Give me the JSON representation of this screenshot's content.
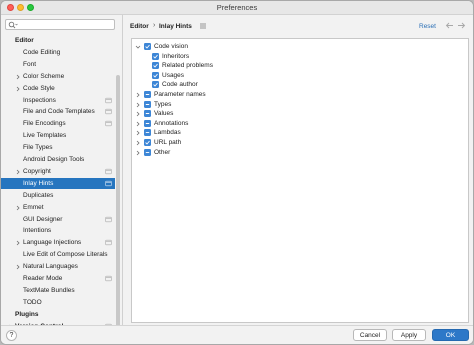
{
  "window": {
    "title": "Preferences"
  },
  "sidebar": {
    "search": {
      "placeholder": ""
    },
    "items": [
      {
        "label": "Editor",
        "bold": true,
        "level": 0,
        "arrow": "none"
      },
      {
        "label": "Code Editing",
        "level": 1,
        "arrow": "none"
      },
      {
        "label": "Font",
        "level": 1,
        "arrow": "none"
      },
      {
        "label": "Color Scheme",
        "level": 1,
        "arrow": "right"
      },
      {
        "label": "Code Style",
        "level": 1,
        "arrow": "right"
      },
      {
        "label": "Inspections",
        "level": 1,
        "arrow": "none",
        "badge": true
      },
      {
        "label": "File and Code Templates",
        "level": 1,
        "arrow": "none",
        "badge": true
      },
      {
        "label": "File Encodings",
        "level": 1,
        "arrow": "none",
        "badge": true
      },
      {
        "label": "Live Templates",
        "level": 1,
        "arrow": "none"
      },
      {
        "label": "File Types",
        "level": 1,
        "arrow": "none"
      },
      {
        "label": "Android Design Tools",
        "level": 1,
        "arrow": "none"
      },
      {
        "label": "Copyright",
        "level": 1,
        "arrow": "right",
        "badge": true
      },
      {
        "label": "Inlay Hints",
        "level": 1,
        "arrow": "none",
        "badge": true,
        "selected": true
      },
      {
        "label": "Duplicates",
        "level": 1,
        "arrow": "none"
      },
      {
        "label": "Emmet",
        "level": 1,
        "arrow": "right"
      },
      {
        "label": "GUI Designer",
        "level": 1,
        "arrow": "none",
        "badge": true
      },
      {
        "label": "Intentions",
        "level": 1,
        "arrow": "none"
      },
      {
        "label": "Language Injections",
        "level": 1,
        "arrow": "right",
        "badge": true
      },
      {
        "label": "Live Edit of Compose Literals",
        "level": 1,
        "arrow": "none"
      },
      {
        "label": "Natural Languages",
        "level": 1,
        "arrow": "right"
      },
      {
        "label": "Reader Mode",
        "level": 1,
        "arrow": "none",
        "badge": true
      },
      {
        "label": "TextMate Bundles",
        "level": 1,
        "arrow": "none"
      },
      {
        "label": "TODO",
        "level": 1,
        "arrow": "none"
      },
      {
        "label": "Plugins",
        "bold": true,
        "level": 0,
        "arrow": "none"
      },
      {
        "label": "Version Control",
        "bold": true,
        "level": 0,
        "arrow": "right",
        "badge": true
      }
    ]
  },
  "main": {
    "breadcrumb": {
      "section": "Editor",
      "separator": "›",
      "page": "Inlay Hints"
    },
    "reset_label": "Reset",
    "hints": [
      {
        "label": "Code vision",
        "level": 0,
        "arrow": "down",
        "state": "checked"
      },
      {
        "label": "Inheritors",
        "level": 1,
        "arrow": "none",
        "state": "checked"
      },
      {
        "label": "Related problems",
        "level": 1,
        "arrow": "none",
        "state": "checked"
      },
      {
        "label": "Usages",
        "level": 1,
        "arrow": "none",
        "state": "checked"
      },
      {
        "label": "Code author",
        "level": 1,
        "arrow": "none",
        "state": "checked"
      },
      {
        "label": "Parameter names",
        "level": 0,
        "arrow": "right",
        "state": "partial"
      },
      {
        "label": "Types",
        "level": 0,
        "arrow": "right",
        "state": "partial"
      },
      {
        "label": "Values",
        "level": 0,
        "arrow": "right",
        "state": "partial"
      },
      {
        "label": "Annotations",
        "level": 0,
        "arrow": "right",
        "state": "partial"
      },
      {
        "label": "Lambdas",
        "level": 0,
        "arrow": "right",
        "state": "partial"
      },
      {
        "label": "URL path",
        "level": 0,
        "arrow": "right",
        "state": "checked"
      },
      {
        "label": "Other",
        "level": 0,
        "arrow": "right",
        "state": "partial"
      }
    ]
  },
  "footer": {
    "help_label": "?",
    "cancel_label": "Cancel",
    "apply_label": "Apply",
    "ok_label": "OK"
  },
  "colors": {
    "accent": "#2d78c8",
    "selection": "#2675bf",
    "checkbox": "#3d86d6"
  }
}
